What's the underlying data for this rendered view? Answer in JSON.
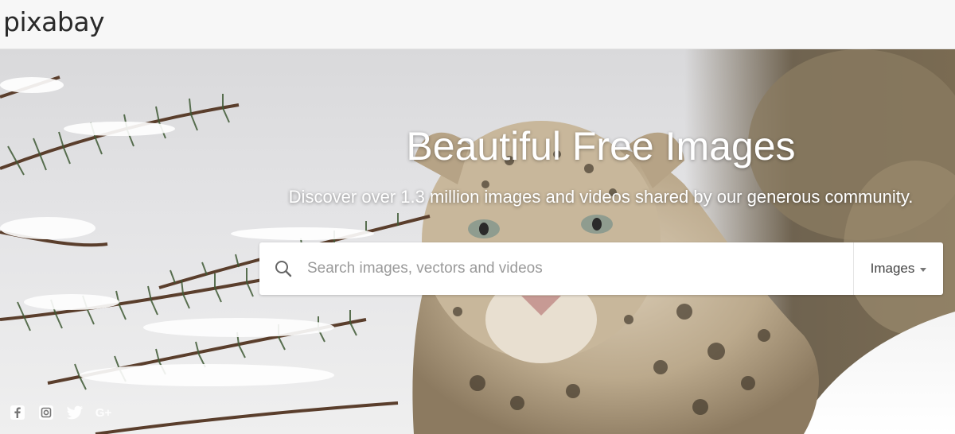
{
  "header": {
    "logo_text": "pixabay"
  },
  "hero": {
    "title": "Beautiful Free Images",
    "subtitle": "Discover over 1.3 million images and videos shared by our generous community."
  },
  "search": {
    "placeholder": "Search images, vectors and videos",
    "value": "",
    "type_selected": "Images"
  },
  "social": {
    "icons": [
      "facebook-icon",
      "instagram-icon",
      "twitter-icon"
    ],
    "gplus_label": "G+"
  },
  "colors": {
    "header_bg": "#f7f7f7",
    "hero_text": "#ffffff",
    "logo_text": "#2a2a2a"
  }
}
